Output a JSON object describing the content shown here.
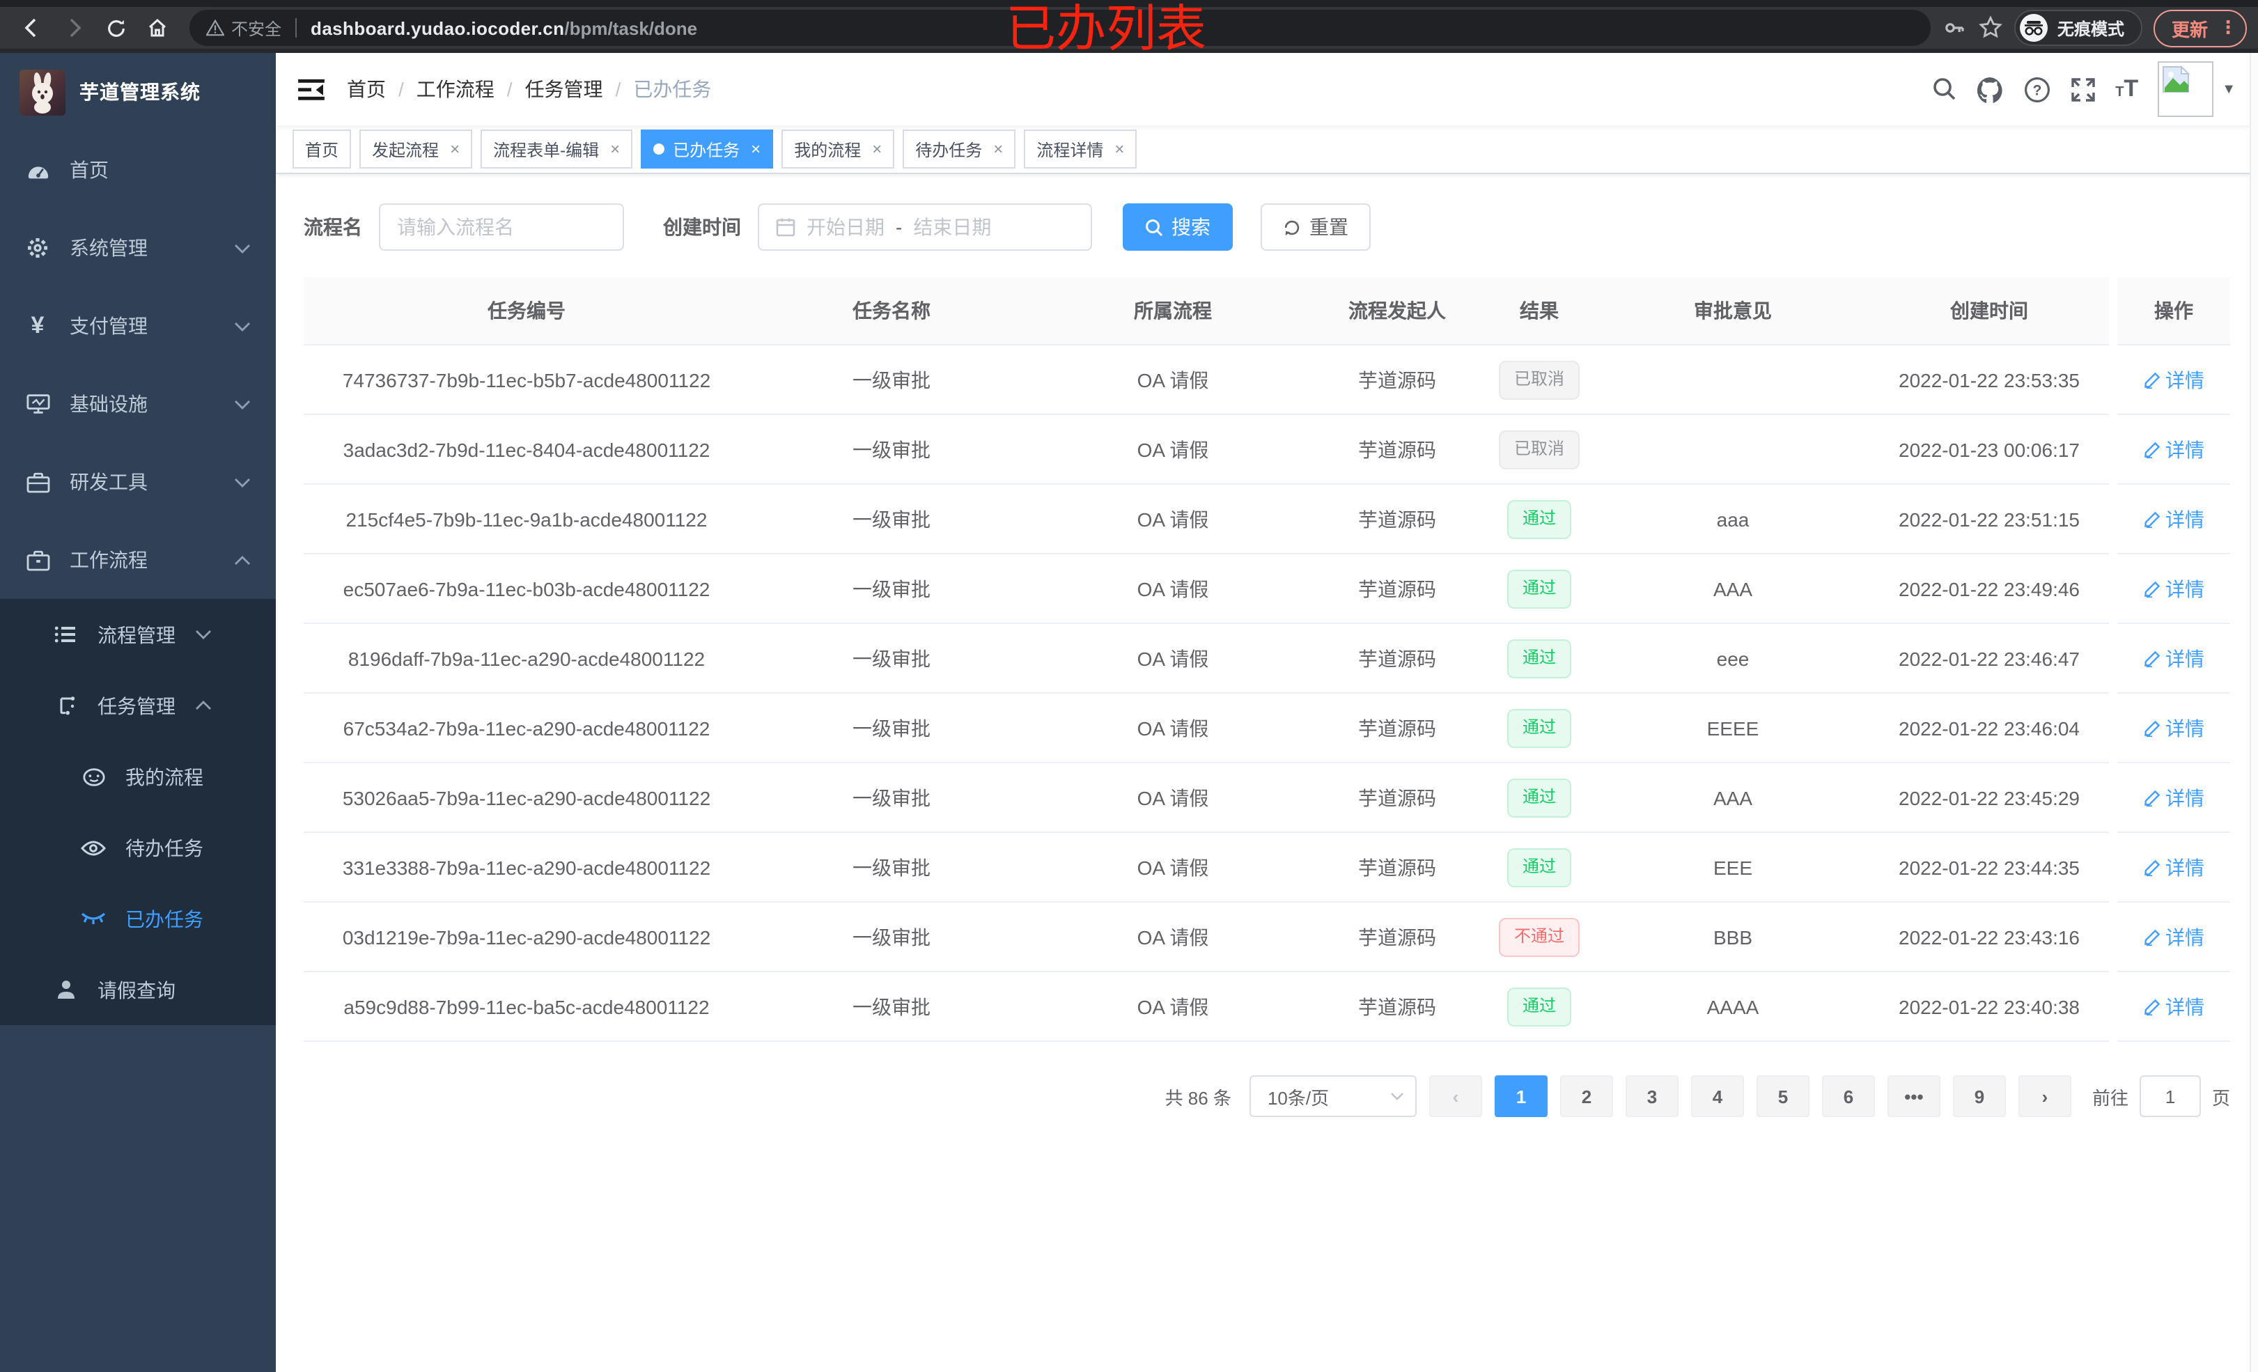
{
  "browser": {
    "security_label": "不安全",
    "url_host": "dashboard.yudao.iocoder.cn",
    "url_path": "/bpm/task/done",
    "incognito_label": "无痕模式",
    "update_label": "更新",
    "menu_glyph": "⋮"
  },
  "annotation": "已办列表",
  "sidebar": {
    "title": "芋道管理系统",
    "items": [
      {
        "label": "首页"
      },
      {
        "label": "系统管理"
      },
      {
        "label": "支付管理"
      },
      {
        "label": "基础设施"
      },
      {
        "label": "研发工具"
      },
      {
        "label": "工作流程"
      },
      {
        "label": "流程管理"
      },
      {
        "label": "任务管理"
      },
      {
        "label": "我的流程"
      },
      {
        "label": "待办任务"
      },
      {
        "label": "已办任务"
      },
      {
        "label": "请假查询"
      }
    ]
  },
  "breadcrumb": {
    "separator": "/",
    "items": [
      "首页",
      "工作流程",
      "任务管理",
      "已办任务"
    ]
  },
  "tabs": [
    {
      "label": "首页"
    },
    {
      "label": "发起流程",
      "close": "×"
    },
    {
      "label": "流程表单-编辑",
      "close": "×"
    },
    {
      "label": "已办任务",
      "close": "×"
    },
    {
      "label": "我的流程",
      "close": "×"
    },
    {
      "label": "待办任务",
      "close": "×"
    },
    {
      "label": "流程详情",
      "close": "×"
    }
  ],
  "search": {
    "name_label": "流程名",
    "name_placeholder": "请输入流程名",
    "time_label": "创建时间",
    "start_placeholder": "开始日期",
    "range_separator": "-",
    "end_placeholder": "结束日期",
    "search_btn": "搜索",
    "reset_btn": "重置"
  },
  "table": {
    "headers": [
      "任务编号",
      "任务名称",
      "所属流程",
      "流程发起人",
      "结果",
      "审批意见",
      "创建时间",
      "操作"
    ],
    "action_label": "详情",
    "rows": [
      {
        "id": "74736737-7b9b-11ec-b5b7-acde48001122",
        "name": "一级审批",
        "process": "OA 请假",
        "starter": "芋道源码",
        "result": "已取消",
        "result_class": "badge cancel",
        "comment": "",
        "time": "2022-01-22 23:53:35",
        "action": "详情"
      },
      {
        "id": "3adac3d2-7b9d-11ec-8404-acde48001122",
        "name": "一级审批",
        "process": "OA 请假",
        "starter": "芋道源码",
        "result": "已取消",
        "result_class": "badge cancel",
        "comment": "",
        "time": "2022-01-23 00:06:17",
        "action": "详情"
      },
      {
        "id": "215cf4e5-7b9b-11ec-9a1b-acde48001122",
        "name": "一级审批",
        "process": "OA 请假",
        "starter": "芋道源码",
        "result": "通过",
        "result_class": "badge pass",
        "comment": "aaa",
        "time": "2022-01-22 23:51:15",
        "action": "详情"
      },
      {
        "id": "ec507ae6-7b9a-11ec-b03b-acde48001122",
        "name": "一级审批",
        "process": "OA 请假",
        "starter": "芋道源码",
        "result": "通过",
        "result_class": "badge pass",
        "comment": "AAA",
        "time": "2022-01-22 23:49:46",
        "action": "详情"
      },
      {
        "id": "8196daff-7b9a-11ec-a290-acde48001122",
        "name": "一级审批",
        "process": "OA 请假",
        "starter": "芋道源码",
        "result": "通过",
        "result_class": "badge pass",
        "comment": "eee",
        "time": "2022-01-22 23:46:47",
        "action": "详情"
      },
      {
        "id": "67c534a2-7b9a-11ec-a290-acde48001122",
        "name": "一级审批",
        "process": "OA 请假",
        "starter": "芋道源码",
        "result": "通过",
        "result_class": "badge pass",
        "comment": "EEEE",
        "time": "2022-01-22 23:46:04",
        "action": "详情"
      },
      {
        "id": "53026aa5-7b9a-11ec-a290-acde48001122",
        "name": "一级审批",
        "process": "OA 请假",
        "starter": "芋道源码",
        "result": "通过",
        "result_class": "badge pass",
        "comment": "AAA",
        "time": "2022-01-22 23:45:29",
        "action": "详情"
      },
      {
        "id": "331e3388-7b9a-11ec-a290-acde48001122",
        "name": "一级审批",
        "process": "OA 请假",
        "starter": "芋道源码",
        "result": "通过",
        "result_class": "badge pass",
        "comment": "EEE",
        "time": "2022-01-22 23:44:35",
        "action": "详情"
      },
      {
        "id": "03d1219e-7b9a-11ec-a290-acde48001122",
        "name": "一级审批",
        "process": "OA 请假",
        "starter": "芋道源码",
        "result": "不通过",
        "result_class": "badge fail",
        "comment": "BBB",
        "time": "2022-01-22 23:43:16",
        "action": "详情"
      },
      {
        "id": "a59c9d88-7b99-11ec-ba5c-acde48001122",
        "name": "一级审批",
        "process": "OA 请假",
        "starter": "芋道源码",
        "result": "通过",
        "result_class": "badge pass",
        "comment": "AAAA",
        "time": "2022-01-22 23:40:38",
        "action": "详情"
      }
    ]
  },
  "pagination": {
    "total": "共 86 条",
    "page_size": "10条/页",
    "prev": "‹",
    "next": "›",
    "pages": [
      "1",
      "2",
      "3",
      "4",
      "5",
      "6",
      "•••",
      "9"
    ],
    "goto_label": "前往",
    "goto_value": "1",
    "goto_suffix": "页"
  }
}
